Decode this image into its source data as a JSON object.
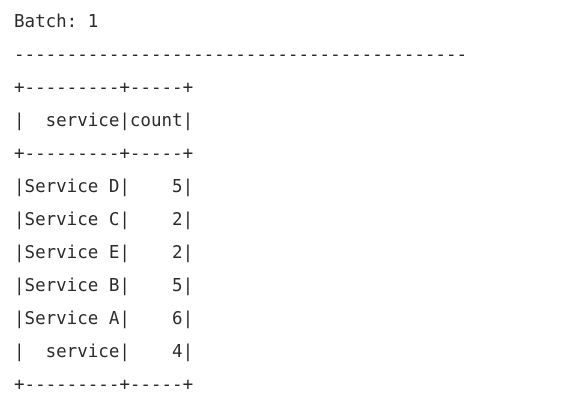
{
  "console": {
    "header": "Batch: 1",
    "separator": "-------------------------------------------",
    "table": {
      "border": "+---------+-----+",
      "header_row": "|  service|count|",
      "rows": [
        "|Service D|    5|",
        "|Service C|    2|",
        "|Service E|    2|",
        "|Service B|    5|",
        "|Service A|    6|",
        "|  service|    4|"
      ]
    }
  }
}
